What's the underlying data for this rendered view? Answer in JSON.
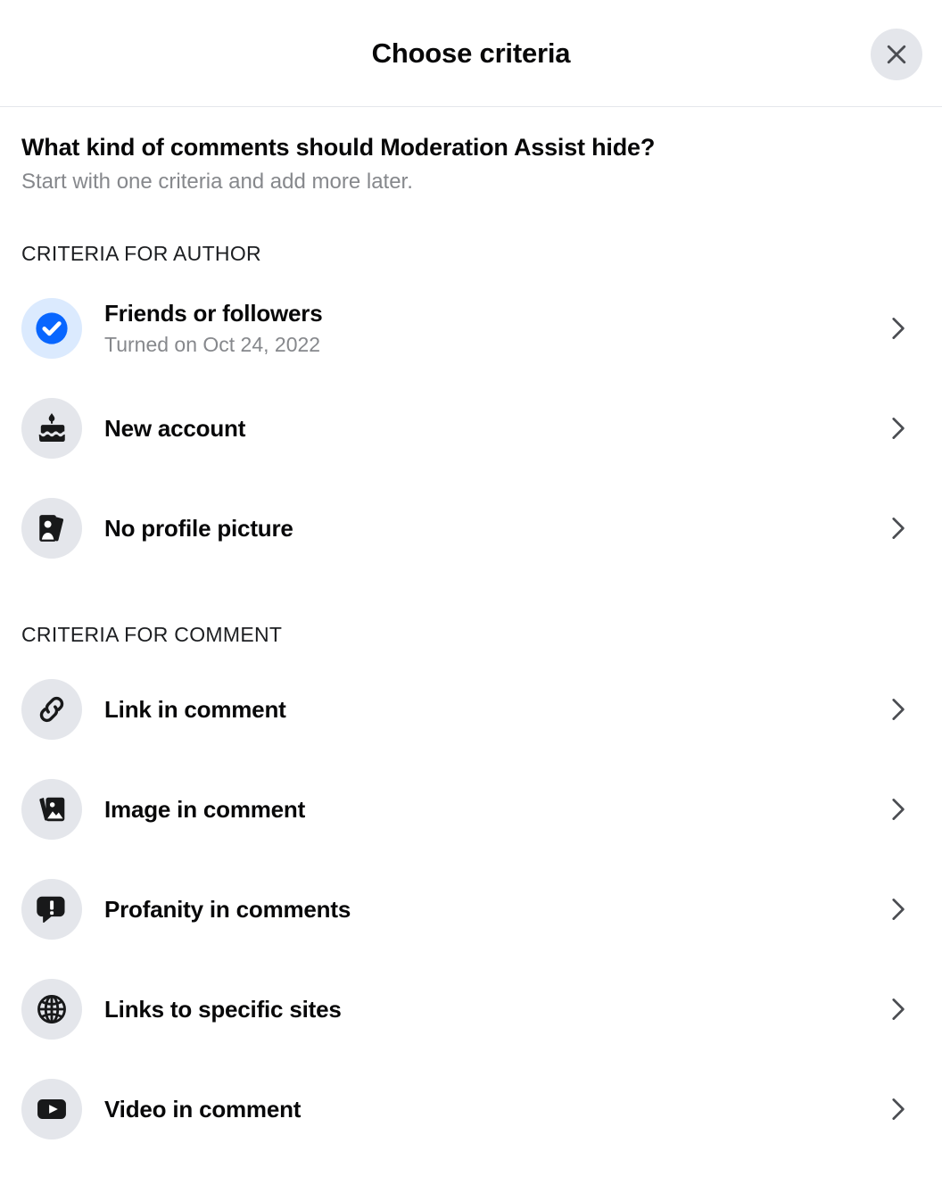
{
  "header": {
    "title": "Choose criteria",
    "close_icon": "close-icon"
  },
  "intro": {
    "title": "What kind of comments should Moderation Assist hide?",
    "subtitle": "Start with one criteria and add more later."
  },
  "colors": {
    "accent_blue": "#0866ff",
    "selected_icon_bg": "#dbeafe",
    "icon_bg": "#e4e6eb",
    "text_primary": "#080809",
    "text_secondary": "#86888c",
    "divider": "#e4e6eb",
    "chevron": "#4b4d52"
  },
  "sections": [
    {
      "label": "CRITERIA FOR AUTHOR",
      "items": [
        {
          "title": "Friends or followers",
          "subtitle": "Turned on Oct 24, 2022",
          "icon": "check-circle-icon",
          "selected": true,
          "chevron_icon": "chevron-right-icon"
        },
        {
          "title": "New account",
          "subtitle": "",
          "icon": "birthday-cake-icon",
          "selected": false,
          "chevron_icon": "chevron-right-icon"
        },
        {
          "title": "No profile picture",
          "subtitle": "",
          "icon": "id-card-icon",
          "selected": false,
          "chevron_icon": "chevron-right-icon"
        }
      ]
    },
    {
      "label": "CRITERIA FOR COMMENT",
      "items": [
        {
          "title": "Link in comment",
          "subtitle": "",
          "icon": "link-icon",
          "selected": false,
          "chevron_icon": "chevron-right-icon"
        },
        {
          "title": "Image in comment",
          "subtitle": "",
          "icon": "photo-icon",
          "selected": false,
          "chevron_icon": "chevron-right-icon"
        },
        {
          "title": "Profanity in comments",
          "subtitle": "",
          "icon": "speech-bubble-alert-icon",
          "selected": false,
          "chevron_icon": "chevron-right-icon"
        },
        {
          "title": "Links to specific sites",
          "subtitle": "",
          "icon": "globe-icon",
          "selected": false,
          "chevron_icon": "chevron-right-icon"
        },
        {
          "title": "Video in comment",
          "subtitle": "",
          "icon": "video-play-icon",
          "selected": false,
          "chevron_icon": "chevron-right-icon"
        }
      ]
    }
  ]
}
